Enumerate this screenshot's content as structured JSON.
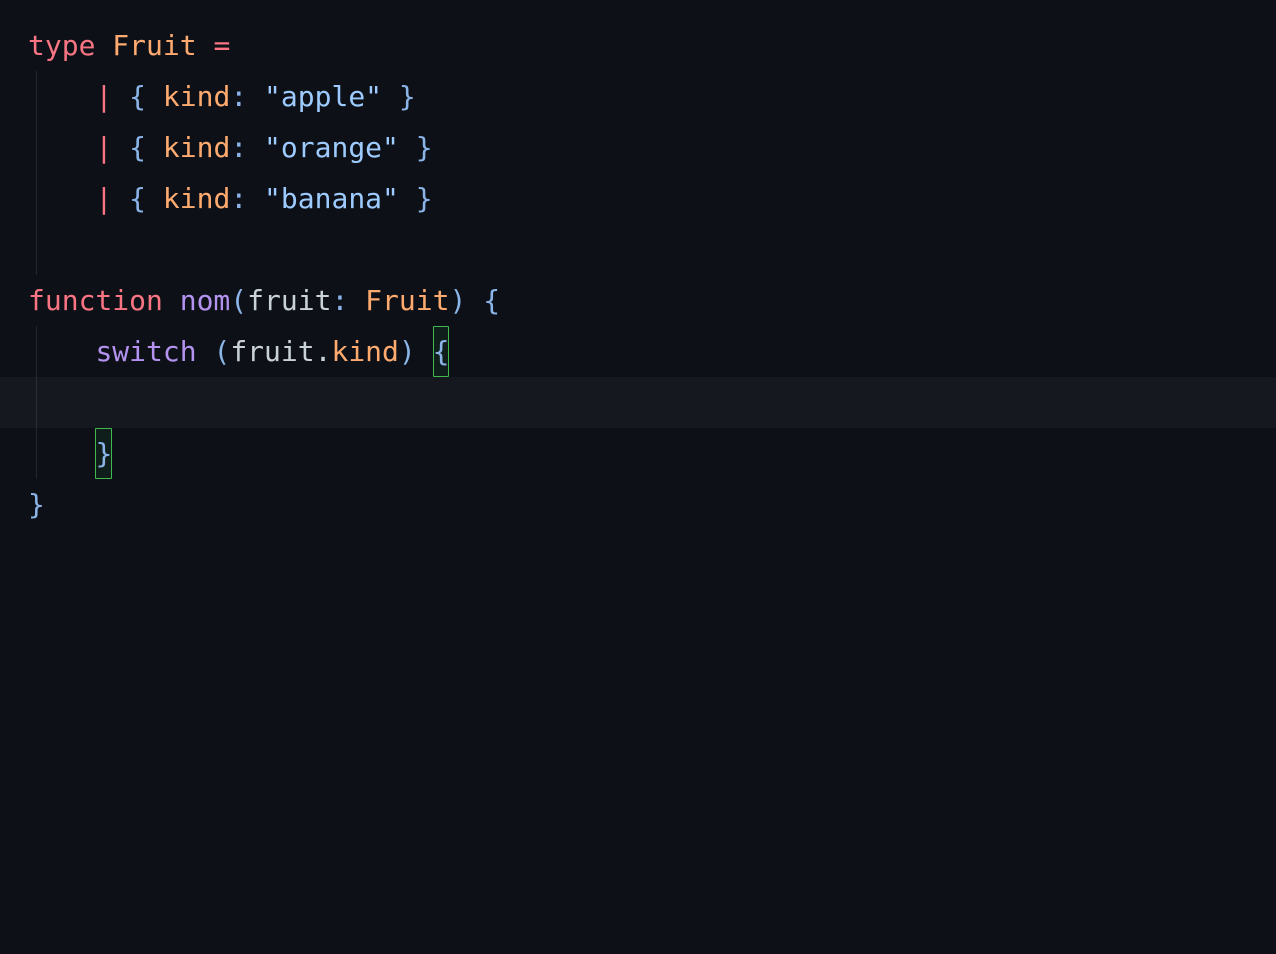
{
  "code": {
    "kw_type": "type",
    "type_name": "Fruit",
    "op_eq": "=",
    "op_pipe": "|",
    "brace_open": "{",
    "brace_close": "}",
    "paren_open": "(",
    "paren_close": ")",
    "colon": ":",
    "prop_kind": "kind",
    "str_apple": "\"apple\"",
    "str_orange": "\"orange\"",
    "str_banana": "\"banana\"",
    "kw_function": "function",
    "fn_name": "nom",
    "param_name": "fruit",
    "kw_switch": "switch",
    "member_fruit": "fruit",
    "member_kind": "kind",
    "dot": "."
  }
}
